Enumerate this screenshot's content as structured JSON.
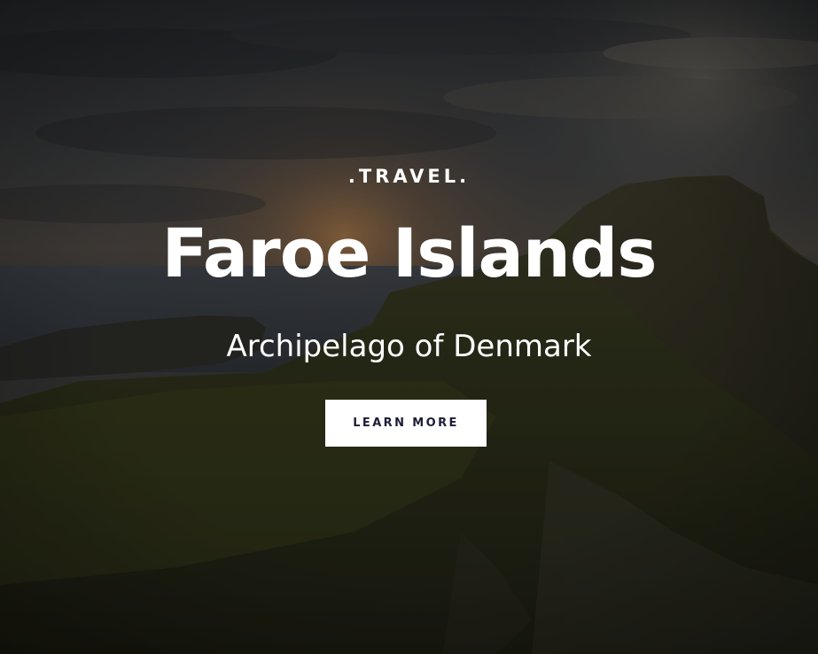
{
  "hero": {
    "eyebrow": ".TRAVEL.",
    "title": "Faroe Islands",
    "subtitle": "Archipelago of Denmark",
    "cta_label": "LEARN MORE"
  },
  "colors": {
    "text": "#ffffff",
    "button_bg": "#ffffff",
    "button_text": "#1e1d36"
  }
}
